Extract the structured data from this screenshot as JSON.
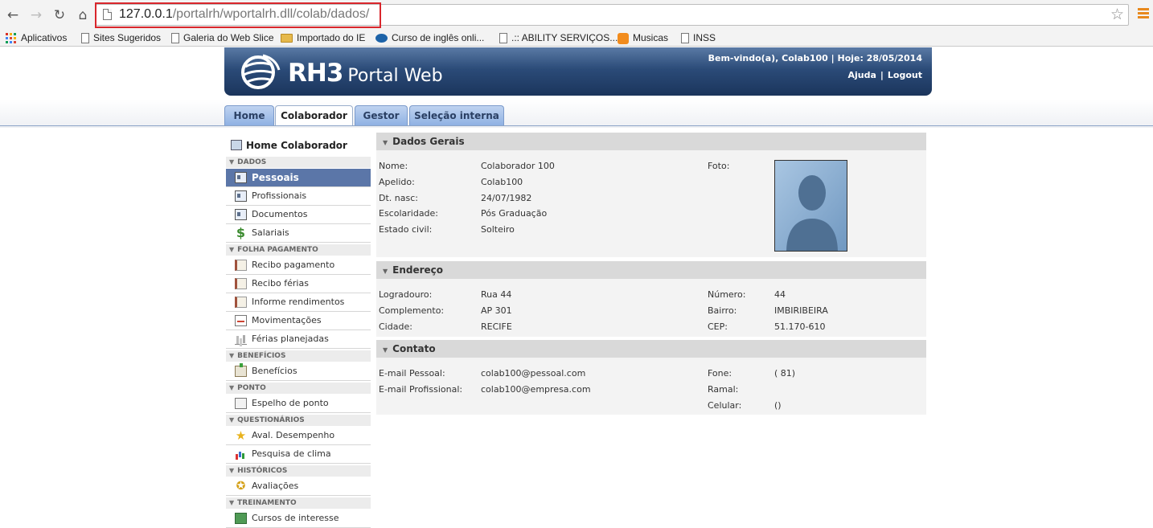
{
  "browser": {
    "url_host": "127.0.0.1",
    "url_path": "/portalrh/wportalrh.dll/colab/dados/",
    "bookmarks": [
      {
        "label": "Aplicativos",
        "icon": "apps-grid-icon"
      },
      {
        "label": "Sites Sugeridos",
        "icon": "page-icon"
      },
      {
        "label": "Galeria do Web Slice",
        "icon": "page-icon"
      },
      {
        "label": "Importado do IE",
        "icon": "folder-icon"
      },
      {
        "label": "Curso de inglês onli...",
        "icon": "chat-bubble-icon"
      },
      {
        "label": ".:: ABILITY SERVIÇOS...",
        "icon": "page-icon"
      },
      {
        "label": "Musicas",
        "icon": "music-icon"
      },
      {
        "label": "INSS",
        "icon": "page-icon"
      }
    ]
  },
  "header": {
    "logo_rh3": "RH3",
    "logo_portal": "Portal Web",
    "welcome": "Bem-vindo(a), Colab100 | Hoje: 28/05/2014",
    "help": "Ajuda",
    "separator": "|",
    "logout": "Logout"
  },
  "tabs": [
    {
      "label": "Home"
    },
    {
      "label": "Colaborador",
      "active": true
    },
    {
      "label": "Gestor"
    },
    {
      "label": "Seleção interna"
    }
  ],
  "sidebar": {
    "home": "Home Colaborador",
    "sections": {
      "dados": "DADOS",
      "folha": "FOLHA PAGAMENTO",
      "beneficios": "BENEFÍCIOS",
      "ponto": "PONTO",
      "questionarios": "QUESTIONÁRIOS",
      "historicos": "HISTÓRICOS",
      "treinamento": "TREINAMENTO"
    },
    "items": {
      "pessoais": "Pessoais",
      "profissionais": "Profissionais",
      "documentos": "Documentos",
      "salariais": "Salariais",
      "recibo_pagamento": "Recibo pagamento",
      "recibo_ferias": "Recibo férias",
      "informe": "Informe rendimentos",
      "movimentacoes": "Movimentações",
      "ferias_planejadas": "Férias planejadas",
      "beneficios": "Benefícios",
      "espelho": "Espelho de ponto",
      "aval": "Aval. Desempenho",
      "pesquisa": "Pesquisa de clima",
      "avaliacoes": "Avaliações",
      "cursos": "Cursos de interesse"
    }
  },
  "dados_gerais": {
    "title": "Dados Gerais",
    "nome_label": "Nome:",
    "nome": "Colaborador 100",
    "apelido_label": "Apelido:",
    "apelido": "Colab100",
    "nasc_label": "Dt. nasc:",
    "nasc": "24/07/1982",
    "escolaridade_label": "Escolaridade:",
    "escolaridade": "Pós Graduação",
    "estado_civil_label": "Estado civil:",
    "estado_civil": "Solteiro",
    "foto_label": "Foto:"
  },
  "endereco": {
    "title": "Endereço",
    "logradouro_label": "Logradouro:",
    "logradouro": "Rua 44",
    "complemento_label": "Complemento:",
    "complemento": "AP 301",
    "cidade_label": "Cidade:",
    "cidade": "RECIFE",
    "numero_label": "Número:",
    "numero": "44",
    "bairro_label": "Bairro:",
    "bairro": "IMBIRIBEIRA",
    "cep_label": "CEP:",
    "cep": "51.170-610"
  },
  "contato": {
    "title": "Contato",
    "email_pessoal_label": "E-mail Pessoal:",
    "email_pessoal": "colab100@pessoal.com",
    "email_prof_label": "E-mail Profissional:",
    "email_prof": "colab100@empresa.com",
    "fone_label": "Fone:",
    "fone": "( 81)",
    "ramal_label": "Ramal:",
    "ramal": "",
    "celular_label": "Celular:",
    "celular": "()"
  },
  "colors": {
    "banner": "#2b4b78",
    "tab": "#8fb1e3",
    "active_item": "#5b76a8",
    "url_highlight": "#d9262c"
  }
}
